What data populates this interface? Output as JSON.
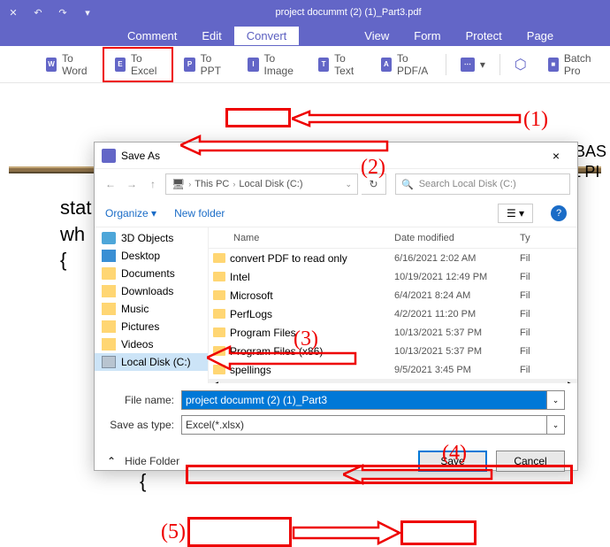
{
  "titlebar": {
    "filename": "project docummt (2) (1)_Part3.pdf"
  },
  "menu": {
    "comment": "Comment",
    "edit": "Edit",
    "convert": "Convert",
    "view": "View",
    "form": "Form",
    "protect": "Protect",
    "page": "Page"
  },
  "toolbar": {
    "to_word": "To Word",
    "to_excel": "To Excel",
    "to_ppt": "To PPT",
    "to_image": "To Image",
    "to_text": "To Text",
    "to_pdfa": "To PDF/A",
    "batch": "Batch Pro",
    "icon_w": "W",
    "icon_e": "E",
    "icon_p": "P",
    "icon_i": "I",
    "icon_t": "T",
    "icon_a": "A"
  },
  "doc": {
    "right1": "RM BAS",
    "right2": "RIAL PI",
    "left1": "stat",
    "left2": "wh",
    "left3": "{",
    "left4": "{"
  },
  "dialog": {
    "title": "Save As",
    "close": "×",
    "path": {
      "this_pc": "This PC",
      "disk": "Local Disk (C:)"
    },
    "search_placeholder": "Search Local Disk (C:)",
    "organize": "Organize ▾",
    "new_folder": "New folder",
    "sidebar": {
      "s0": "3D Objects",
      "s1": "Desktop",
      "s2": "Documents",
      "s3": "Downloads",
      "s4": "Music",
      "s5": "Pictures",
      "s6": "Videos",
      "s7": "Local Disk (C:)"
    },
    "columns": {
      "name": "Name",
      "date": "Date modified",
      "type": "Ty"
    },
    "files": [
      {
        "name": "convert PDF to read only",
        "date": "6/16/2021 2:02 AM",
        "type": "Fil"
      },
      {
        "name": "Intel",
        "date": "10/19/2021 12:49 PM",
        "type": "Fil"
      },
      {
        "name": "Microsoft",
        "date": "6/4/2021 8:24 AM",
        "type": "Fil"
      },
      {
        "name": "PerfLogs",
        "date": "4/2/2021 11:20 PM",
        "type": "Fil"
      },
      {
        "name": "Program Files",
        "date": "10/13/2021 5:37 PM",
        "type": "Fil"
      },
      {
        "name": "Program Files (x86)",
        "date": "10/13/2021 5:37 PM",
        "type": "Fil"
      },
      {
        "name": "spellings",
        "date": "9/5/2021 3:45 PM",
        "type": "Fil"
      }
    ],
    "filename_label": "File name:",
    "filename_value": "project docummt (2) (1)_Part3",
    "saveas_label": "Save as type:",
    "saveas_value": "Excel(*.xlsx)",
    "hide_folders": "Hide Folder",
    "save": "Save",
    "cancel": "Cancel"
  },
  "annotations": {
    "n1": "(1)",
    "n2": "(2)",
    "n3": "(3)",
    "n4": "(4)",
    "n5": "(5)"
  }
}
